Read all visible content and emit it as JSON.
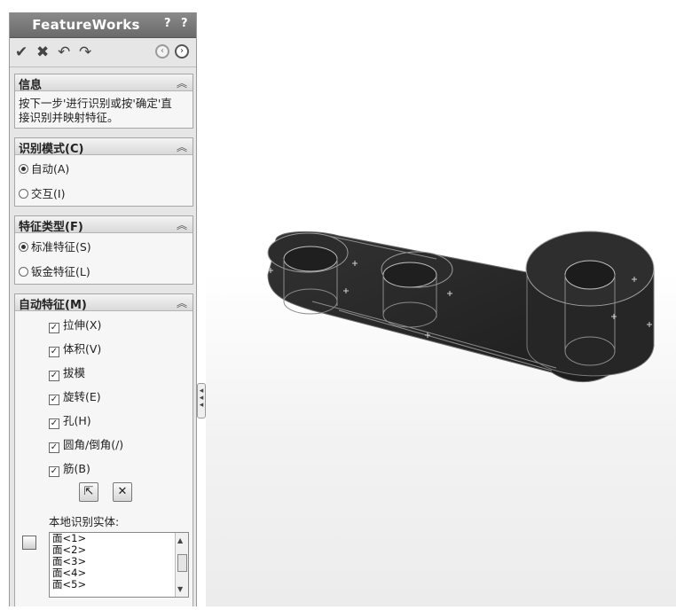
{
  "panel": {
    "title": "FeatureWorks",
    "help_icons": "? ?",
    "toolbar": [
      "ok-check-icon",
      "cancel-x-icon",
      "undo-icon",
      "redo-icon",
      "back-icon",
      "next-icon"
    ]
  },
  "info": {
    "header": "信息",
    "line1": "按下一步'进行识别或按'确定'直",
    "line2": "接识别并映射特征。"
  },
  "mode": {
    "header": "识别模式(C)",
    "options": [
      {
        "label": "自动(A)",
        "selected": true
      },
      {
        "label": "交互(I)",
        "selected": false
      }
    ]
  },
  "feature_type": {
    "header": "特征类型(F)",
    "options": [
      {
        "label": "标准特征(S)",
        "selected": true
      },
      {
        "label": "钣金特征(L)",
        "selected": false
      }
    ]
  },
  "auto": {
    "header": "自动特征(M)",
    "items": [
      "拉伸(X)",
      "体积(V)",
      "拔模",
      "旋转(E)",
      "孔(H)",
      "圆角/倒角(/)",
      "筋(B)"
    ],
    "local_label": "本地识别实体:",
    "list": [
      "面<1>",
      "面<2>",
      "面<3>",
      "面<4>",
      "面<5>"
    ]
  },
  "colors": {
    "panel_bg": "#e6e6e6",
    "titlebar": "#7a7a7a",
    "model": "#2b2b2b"
  }
}
